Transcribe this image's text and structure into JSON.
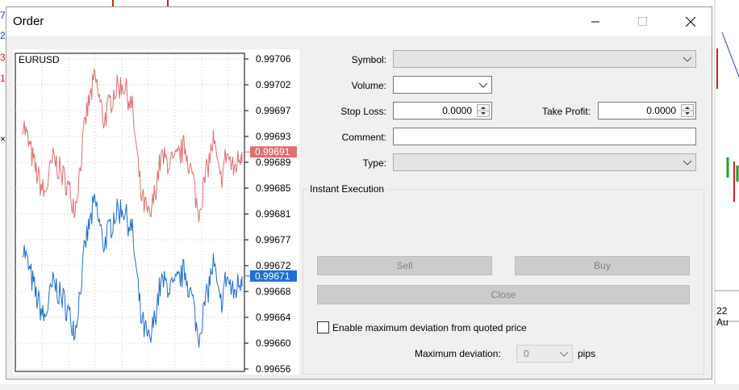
{
  "window": {
    "title": "Order"
  },
  "background": {
    "fragments": [
      "7",
      "2",
      "3",
      "1",
      "×"
    ],
    "date_fragment": "22 Au"
  },
  "chart": {
    "symbol": "EURUSD",
    "price_scale": [
      "0.99706",
      "0.99702",
      "0.99697",
      "0.99693",
      "0.99689",
      "0.99685",
      "0.99681",
      "0.99677",
      "0.99672",
      "0.99668",
      "0.99664",
      "0.99660",
      "0.99656"
    ],
    "ask_price": "0.99691",
    "bid_price": "0.99671",
    "ask_color": "#e07070",
    "bid_color": "#1f6fd0"
  },
  "form": {
    "symbol_label": "Symbol:",
    "symbol_value": "",
    "volume_label": "Volume:",
    "volume_value": "",
    "stop_loss_label": "Stop Loss:",
    "stop_loss_value": "0.0000",
    "take_profit_label": "Take Profit:",
    "take_profit_value": "0.0000",
    "comment_label": "Comment:",
    "comment_value": "",
    "type_label": "Type:",
    "type_value": ""
  },
  "execution": {
    "group_title": "Instant Execution",
    "sell_label": "Sell",
    "buy_label": "Buy",
    "close_label": "Close",
    "max_dev_checkbox_label": "Enable maximum deviation from quoted price",
    "max_dev_checked": false,
    "max_dev_label": "Maximum deviation:",
    "max_dev_value": "0",
    "pips_label": "pips"
  }
}
